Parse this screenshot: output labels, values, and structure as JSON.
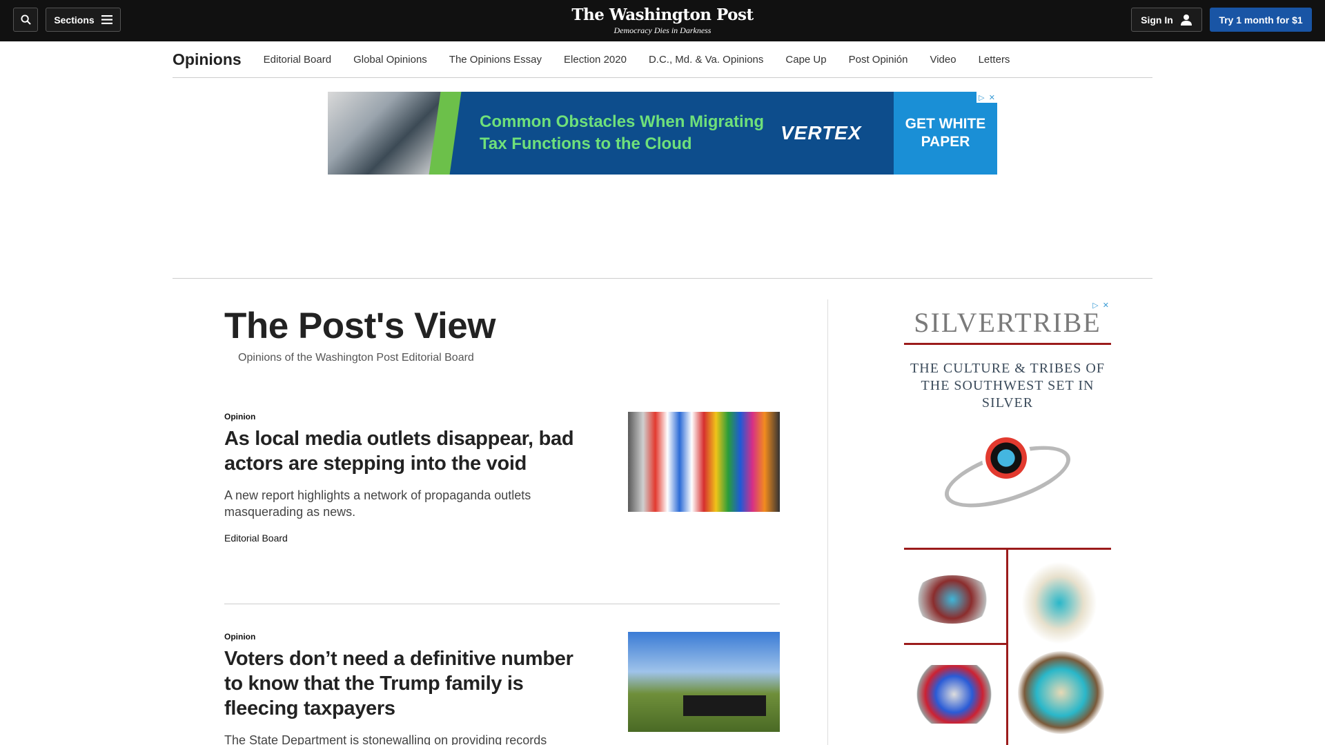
{
  "header": {
    "sections_label": "Sections",
    "logo_title": "The Washington Post",
    "logo_tagline": "Democracy Dies in Darkness",
    "signin_label": "Sign In",
    "try_label": "Try 1 month for $1"
  },
  "subnav": {
    "title": "Opinions",
    "items": [
      "Editorial Board",
      "Global Opinions",
      "The Opinions Essay",
      "Election 2020",
      "D.C., Md. & Va. Opinions",
      "Cape Up",
      "Post Opinión",
      "Video",
      "Letters"
    ]
  },
  "top_ad": {
    "headline": "Common Obstacles When Migrating Tax Functions to the Cloud",
    "brand": "VERTEX",
    "cta": "GET WHITE PAPER"
  },
  "main": {
    "title": "The Post's View",
    "subtitle": "Opinions of the Washington Post Editorial Board",
    "articles": [
      {
        "kicker": "Opinion",
        "headline": "As local media outlets disappear, bad actors are stepping into the void",
        "blurb": "A new report highlights a network of propaganda outlets masquerading as news.",
        "byline": "Editorial Board"
      },
      {
        "kicker": "Opinion",
        "headline": "Voters don’t need a definitive number to know that the Trump family is fleecing taxpayers",
        "blurb": "The State Department is stonewalling on providing records"
      }
    ]
  },
  "side_ad": {
    "brand": "SILVERTRIBE",
    "tagline": "THE CULTURE & TRIBES OF THE SOUTHWEST SET IN SILVER"
  },
  "colors": {
    "topbar": "#111111",
    "accent_blue": "#1955a5",
    "ad_blue": "#0d4d8c",
    "ad_green": "#6cc04a",
    "side_red": "#9b1b1b"
  },
  "icons": [
    "search-icon",
    "menu-icon",
    "user-icon",
    "ad-info-icon",
    "ad-close-icon"
  ]
}
